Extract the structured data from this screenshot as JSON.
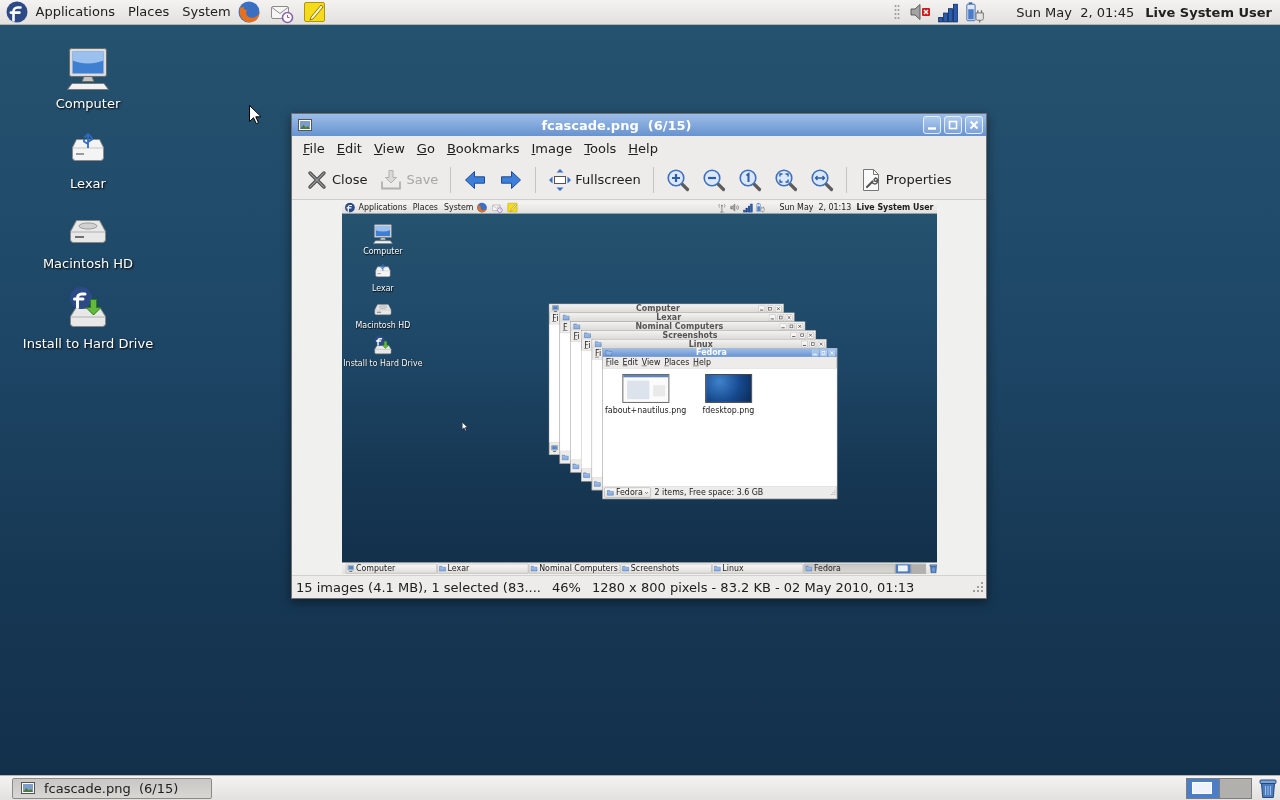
{
  "top_panel": {
    "menus": [
      "Applications",
      "Places",
      "System"
    ],
    "volume": {
      "muted": true
    },
    "clock": "Sun May  2, 01:45",
    "user": "Live System User"
  },
  "desktop_icons": [
    "Computer",
    "Lexar",
    "Macintosh HD",
    "Install to Hard Drive"
  ],
  "viewer_window": {
    "title": "fcascade.png  (6/15)",
    "active": true,
    "menu": [
      "File",
      "Edit",
      "View",
      "Go",
      "Bookmarks",
      "Image",
      "Tools",
      "Help"
    ],
    "toolbar": [
      {
        "label": "Close",
        "disabled": false
      },
      {
        "label": "Save",
        "disabled": true
      },
      {
        "label": "Fullscreen",
        "disabled": false
      },
      {
        "label": "Properties",
        "disabled": false
      }
    ],
    "screenshot": {
      "top_panel": {
        "menus": [
          "Applications",
          "Places",
          "System"
        ],
        "volume": {
          "muted": false
        },
        "clock": "Sun May  2, 01:13",
        "user": "Live System User"
      },
      "desktop_icons": [
        "Computer",
        "Lexar",
        "Macintosh HD",
        "Install to Hard Drive"
      ],
      "windows": [
        {
          "title": "Computer",
          "active": false,
          "menu": [
            "Fi"
          ]
        },
        {
          "title": "Lexar",
          "active": false,
          "menu": [
            "F"
          ]
        },
        {
          "title": "Nominal Computers",
          "active": false,
          "menu": [
            "Fi"
          ]
        },
        {
          "title": "Screenshots",
          "active": false,
          "menu": [
            "Fi"
          ]
        },
        {
          "title": "Linux",
          "active": false,
          "menu": [
            "Fi"
          ]
        },
        {
          "title": "Fedora",
          "active": true,
          "menu": [
            "File",
            "Edit",
            "View",
            "Places",
            "Help"
          ],
          "files": [
            "fabout+nautilus.png",
            "fdesktop.png"
          ],
          "location": "Fedora",
          "status": "2 items, Free space: 3.6 GB"
        }
      ],
      "taskbar": {
        "tasks": [
          {
            "label": "Computer",
            "selected": false
          },
          {
            "label": "Lexar",
            "selected": false
          },
          {
            "label": "Nominal Computers",
            "selected": false
          },
          {
            "label": "Screenshots",
            "selected": false
          },
          {
            "label": "Linux",
            "selected": false
          },
          {
            "label": "Fedora",
            "selected": true
          }
        ],
        "workspaces": [
          {
            "selected": true
          },
          {
            "selected": false
          }
        ]
      }
    },
    "status_bar": [
      "15 images (4.1 MB), 1 selected (83....",
      "46%",
      "1280 x 800 pixels - 83.2 KB - 02 May 2010, 01:13"
    ]
  },
  "taskbar": {
    "tasks": [
      {
        "label": "fcascade.png  (6/15)",
        "selected": true
      }
    ],
    "workspaces": [
      {
        "selected": true
      },
      {
        "selected": false
      }
    ]
  }
}
